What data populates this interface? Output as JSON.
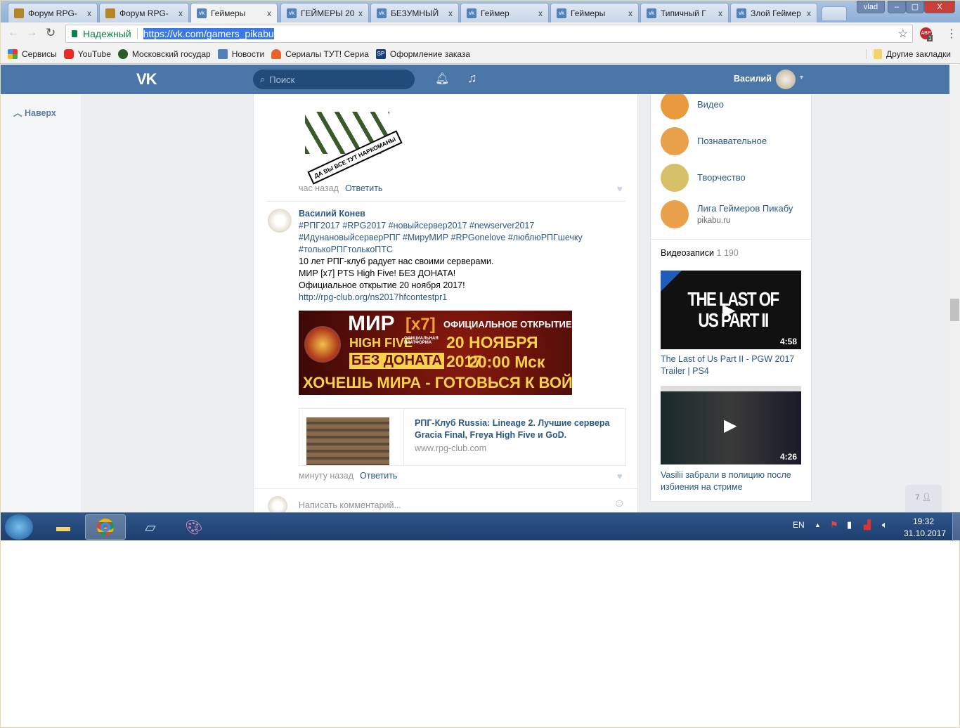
{
  "browser": {
    "tabs": [
      {
        "title": "Форум RPG-",
        "icon": "rpg"
      },
      {
        "title": "Форум RPG-",
        "icon": "rpg"
      },
      {
        "title": "Геймеры",
        "icon": "vk",
        "active": true
      },
      {
        "title": "ГЕЙМЕРЫ 20",
        "icon": "vk"
      },
      {
        "title": "БЕЗУМНЫЙ",
        "icon": "vk"
      },
      {
        "title": "Геймер",
        "icon": "vk"
      },
      {
        "title": "Геймеры",
        "icon": "vk"
      },
      {
        "title": "Типичный Г",
        "icon": "vk"
      },
      {
        "title": "Злой Геймер",
        "icon": "vk"
      }
    ],
    "close_glyph": "x",
    "profile": "vlad",
    "secure_label": "Надежный",
    "url": "https://vk.com/gamers_pikabu",
    "abp_badge": "1",
    "bookmarks": [
      "Сервисы",
      "YouTube",
      "Московский государ",
      "Новости",
      "Сериалы ТУТ! Сериа",
      "Оформление заказа"
    ],
    "other_bookmarks": "Другие закладки"
  },
  "vk": {
    "search_placeholder": "Поиск",
    "user_name": "Василий",
    "back_top": "Наверх",
    "meme_caption": "ДА ВЫ ВСЕ ТУТ НАРКОМАНЫ",
    "comment1": {
      "time": "час назад",
      "reply": "Ответить"
    },
    "comment2": {
      "author": "Василий Конев",
      "tags1": "#РПГ2017 #RPG2017 #новыйсервер2017 #newserver2017",
      "tags2": "#ИдунановыйсерверРПГ #МируМИР #RPGonelove #люблюРПГшечку",
      "tags3": "#толькоРПГтолькоПТС",
      "line1": "10 лет РПГ-клуб радует нас своими серверами.",
      "line2": "МИР [x7] PTS High Five! БЕЗ ДОНАТА!",
      "line3": "Официальное открытие 20 ноября 2017!",
      "link": "http://rpg-club.org/ns2017hfcontestpr1",
      "banner": {
        "mir": "МИР",
        "x7": "[x7]",
        "hf": "HIGH FIVE",
        "platform": "ОФИЦИАЛЬНАЯ ПЛАТФОРМА",
        "donate": "БЕЗ ДОНАТА",
        "open": "ОФИЦИАЛЬНОЕ ОТКРЫТИЕ",
        "date": "20 НОЯБРЯ 2017",
        "time": "20:00 Мск",
        "slogan": "ХОЧЕШЬ МИРА - ГОТОВЬСЯ К ВОЙНЕ"
      },
      "snippet": {
        "title": "РПГ-Клуб Russia: Lineage 2. Лучшие сервера Gracia Final, Freya High Five и GoD. Официальн...",
        "domain": "www.rpg-club.com"
      },
      "time": "минуту назад",
      "reply": "Ответить"
    },
    "comment_placeholder": "Написать комментарий...",
    "groups": [
      {
        "name": "Видео",
        "sub": ""
      },
      {
        "name": "Познавательное",
        "sub": ""
      },
      {
        "name": "Творчество",
        "sub": ""
      },
      {
        "name": "Лига Геймеров Пикабу",
        "sub": "pikabu.ru"
      }
    ],
    "videos_label": "Видеозаписи",
    "videos_count": "1 190",
    "videos": [
      {
        "title": "The Last of Us Part II - PGW 2017 Trailer | PS4",
        "duration": "4:58",
        "thumb_text": "THE LAST OF US PART II"
      },
      {
        "title": "Vasilii забрали в полицию после избиения на стриме",
        "duration": "4:26"
      }
    ],
    "friends_online": "7"
  },
  "taskbar": {
    "lang": "EN",
    "time": "19:32",
    "date": "31.10.2017"
  }
}
